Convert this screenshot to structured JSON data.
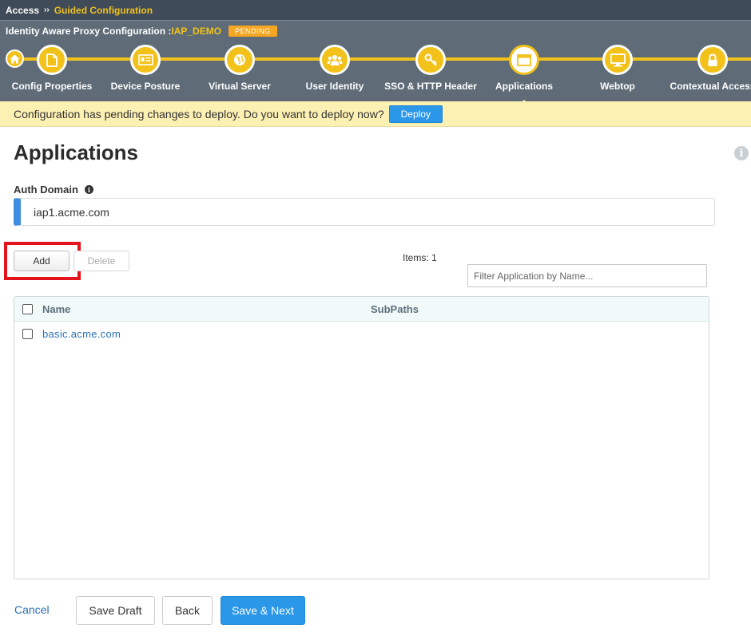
{
  "breadcrumb": {
    "root": "Access",
    "separator": "››",
    "current": "Guided Configuration"
  },
  "config": {
    "label": "Identity Aware Proxy Configuration :",
    "name": "IAP_DEMO",
    "status": "PENDING"
  },
  "wizard": {
    "home_icon": "home-icon",
    "steps": [
      {
        "label": "Config Properties",
        "icon": "document-icon"
      },
      {
        "label": "Device Posture",
        "icon": "id-card-icon"
      },
      {
        "label": "Virtual Server",
        "icon": "globe-icon"
      },
      {
        "label": "User Identity",
        "icon": "users-icon"
      },
      {
        "label": "SSO & HTTP Header",
        "icon": "key-icon"
      },
      {
        "label": "Applications",
        "icon": "window-icon",
        "active": true
      },
      {
        "label": "Webtop",
        "icon": "monitor-icon"
      },
      {
        "label": "Contextual Access",
        "icon": "lock-icon"
      }
    ]
  },
  "banner": {
    "message": "Configuration has pending changes to deploy. Do you want to deploy now?",
    "deploy_label": "Deploy"
  },
  "page": {
    "title": "Applications"
  },
  "auth_domain": {
    "label": "Auth Domain",
    "value": "iap1.acme.com"
  },
  "toolbar": {
    "add_label": "Add",
    "delete_label": "Delete",
    "items_count": "Items: 1"
  },
  "filter": {
    "placeholder": "Filter Application by Name..."
  },
  "grid": {
    "columns": [
      "Name",
      "SubPaths"
    ],
    "rows": [
      {
        "name": "basic.acme.com",
        "subpaths": ""
      }
    ]
  },
  "footer": {
    "cancel_label": "Cancel",
    "save_draft_label": "Save Draft",
    "back_label": "Back",
    "save_next_label": "Save & Next"
  },
  "colors": {
    "accent_yellow": "#f2c21b",
    "primary_blue": "#2a97e8",
    "highlight_red": "#e3141c",
    "header_gray": "#5f6c78"
  }
}
